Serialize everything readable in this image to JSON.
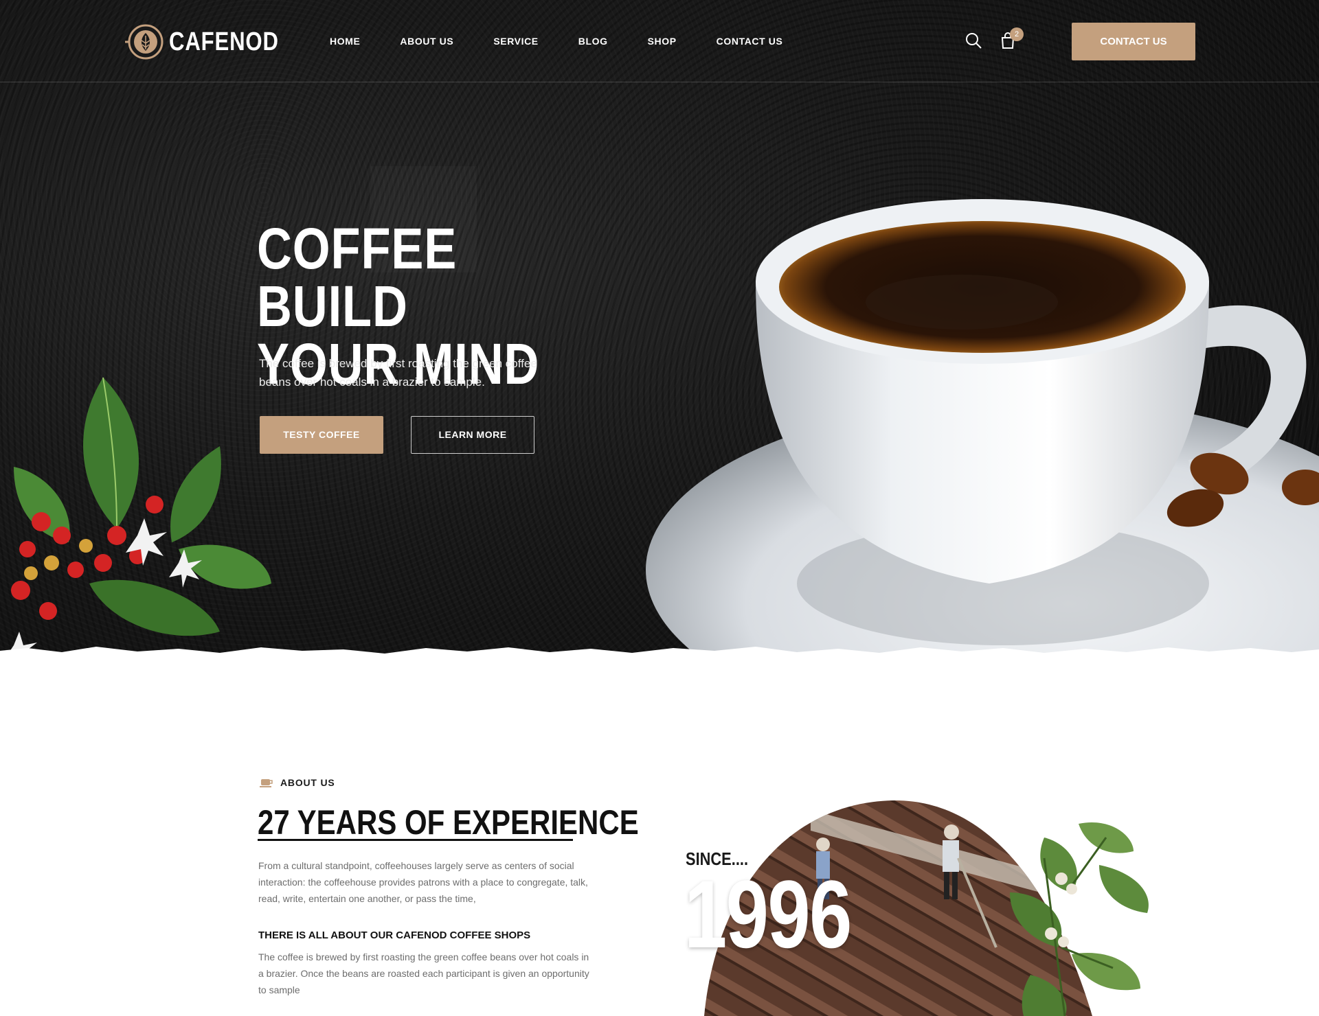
{
  "brand": {
    "name": "CAFENOD"
  },
  "nav": {
    "links": [
      {
        "label": "HOME"
      },
      {
        "label": "ABOUT US"
      },
      {
        "label": "SERVICE"
      },
      {
        "label": "BLOG"
      },
      {
        "label": "SHOP"
      },
      {
        "label": "CONTACT US"
      }
    ],
    "cart_count": "2",
    "contact_button": "CONTACT US"
  },
  "hero": {
    "title_line1": "COFFEE BUILD",
    "title_line2": "YOUR MIND",
    "description": "The coffee is brewed by first roasting the green coffee beans over hot coals in a brazier to sample.",
    "primary_button": "TESTY COFFEE",
    "secondary_button": "LEARN MORE"
  },
  "about": {
    "eyebrow": "ABOUT US",
    "title": "27 YEARS OF EXPERIENCE",
    "paragraph1": "From a cultural standpoint, coffeehouses largely serve as centers of social interaction: the coffeehouse provides patrons with a place to congregate, talk, read, write, entertain one another, or pass the time,",
    "subheading": "THERE IS ALL ABOUT OUR CAFENOD COFFEE SHOPS",
    "paragraph2": "The coffee is brewed by first roasting the green coffee beans over hot coals in a brazier. Once the beans are roasted each participant is given an opportunity to sample",
    "since_label": "SINCE....",
    "since_year": "1996"
  },
  "colors": {
    "accent": "#c4a07e",
    "hero_bg": "#1a1a1a",
    "text_dark": "#111111",
    "text_muted": "#6d6d6d"
  },
  "icons": [
    "logo-coffee-icon",
    "search-icon",
    "shopping-bag-icon",
    "coffee-cup-icon"
  ]
}
